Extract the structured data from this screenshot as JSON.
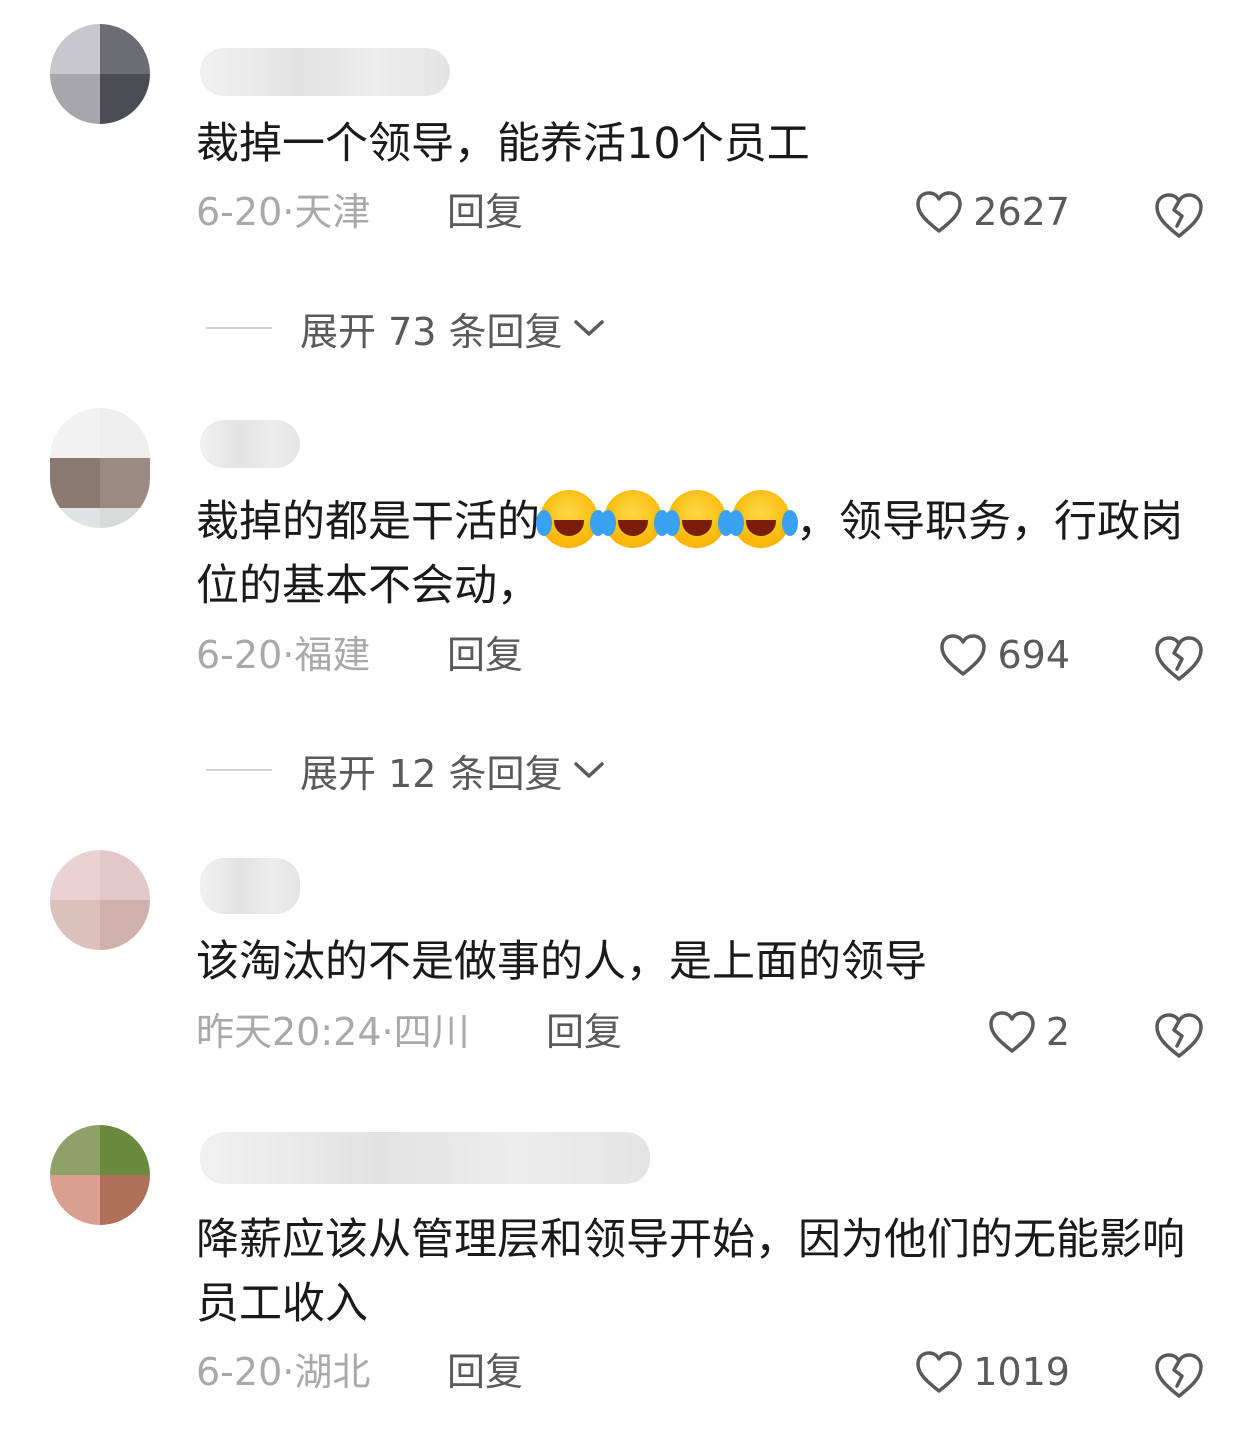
{
  "comments": [
    {
      "text": "裁掉一个领导，能养活10个员工",
      "meta": "6-20·天津",
      "reply_label": "回复",
      "likes": "2627",
      "expand": "展开 73 条回复"
    },
    {
      "text_before": "裁掉的都是干活的",
      "text_after": "，领导职务，行政岗位的基本不会动，",
      "meta": "6-20·福建",
      "reply_label": "回复",
      "likes": "694",
      "expand": "展开 12 条回复",
      "emoji": "crying-laughing-emoji"
    },
    {
      "text": "该淘汰的不是做事的人，是上面的领导",
      "meta": "昨天20:24·四川",
      "reply_label": "回复",
      "likes": "2"
    },
    {
      "text": "降薪应该从管理层和领导开始，因为他们的无能影响员工收入",
      "meta": "6-20·湖北",
      "reply_label": "回复",
      "likes": "1019"
    }
  ],
  "icons": {
    "like": "heart-outline-icon",
    "dislike": "broken-heart-icon",
    "expand": "chevron-down-icon"
  },
  "colors": {
    "text": "#1a1a1a",
    "meta": "#a9a9a9",
    "action": "#5a5a5a"
  }
}
